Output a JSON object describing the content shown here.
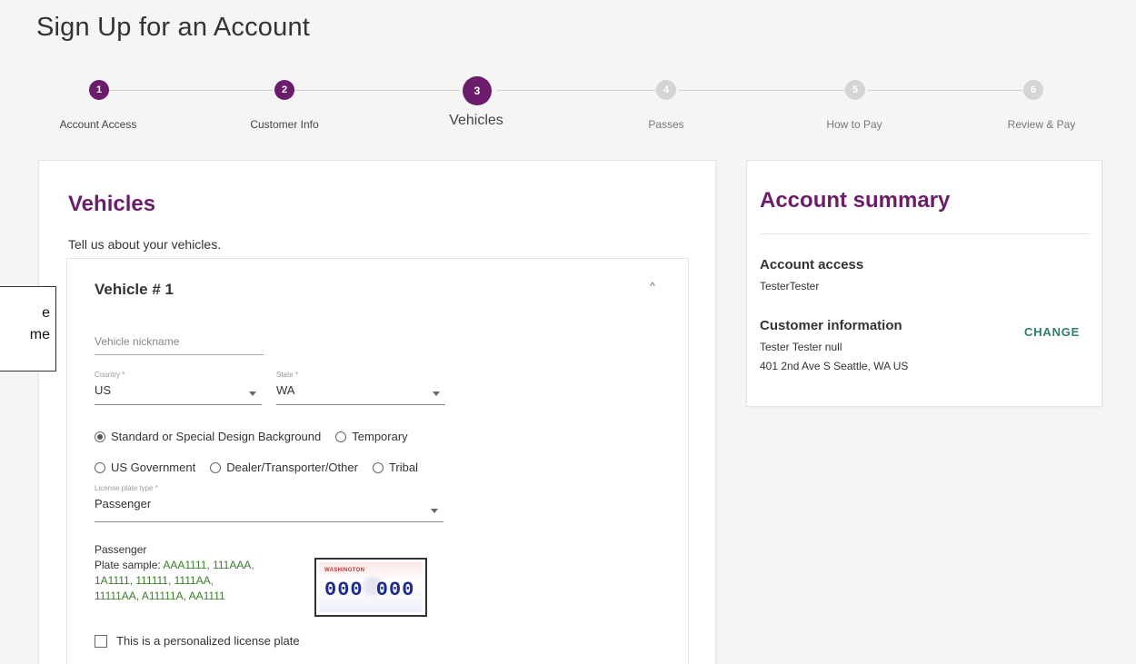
{
  "page_title": "Sign Up for an Account",
  "stepper": {
    "steps": [
      {
        "num": "1",
        "label": "Account Access"
      },
      {
        "num": "2",
        "label": "Customer Info"
      },
      {
        "num": "3",
        "label": "Vehicles"
      },
      {
        "num": "4",
        "label": "Passes"
      },
      {
        "num": "5",
        "label": "How to Pay"
      },
      {
        "num": "6",
        "label": "Review & Pay"
      }
    ]
  },
  "vehicles": {
    "heading": "Vehicles",
    "intro": "Tell us about your vehicles.",
    "vehicle_title": "Vehicle # 1",
    "nickname_placeholder": "Vehicle nickname",
    "country": {
      "label": "Country *",
      "value": "US"
    },
    "state": {
      "label": "State *",
      "value": "WA"
    },
    "radios": {
      "standard": "Standard or Special Design Background",
      "temporary": "Temporary",
      "us_gov": "US Government",
      "dealer": "Dealer/Transporter/Other",
      "tribal": "Tribal"
    },
    "plate_type": {
      "label": "License plate type *",
      "value": "Passenger"
    },
    "plate_info": {
      "title": "Passenger",
      "sample_label": "Plate sample: ",
      "samples_line1": "AAA1111, 111AAA,",
      "samples_line2": "1A1111, 111111, 1111AA,",
      "samples_line3": "11111AA, A11111A, AA1111"
    },
    "plate_image": {
      "state_text": "WASHINGTON",
      "number": "000 000"
    },
    "personalized_label": "This is a personalized license plate"
  },
  "summary": {
    "heading": "Account summary",
    "account_access_h": "Account access",
    "account_access_v": "TesterTester",
    "customer_info_h": "Customer information",
    "customer_name": "Tester Tester null",
    "customer_address": "401 2nd Ave S Seattle, WA US",
    "change": "CHANGE"
  },
  "callout": {
    "line1": "e",
    "line2": "me"
  }
}
